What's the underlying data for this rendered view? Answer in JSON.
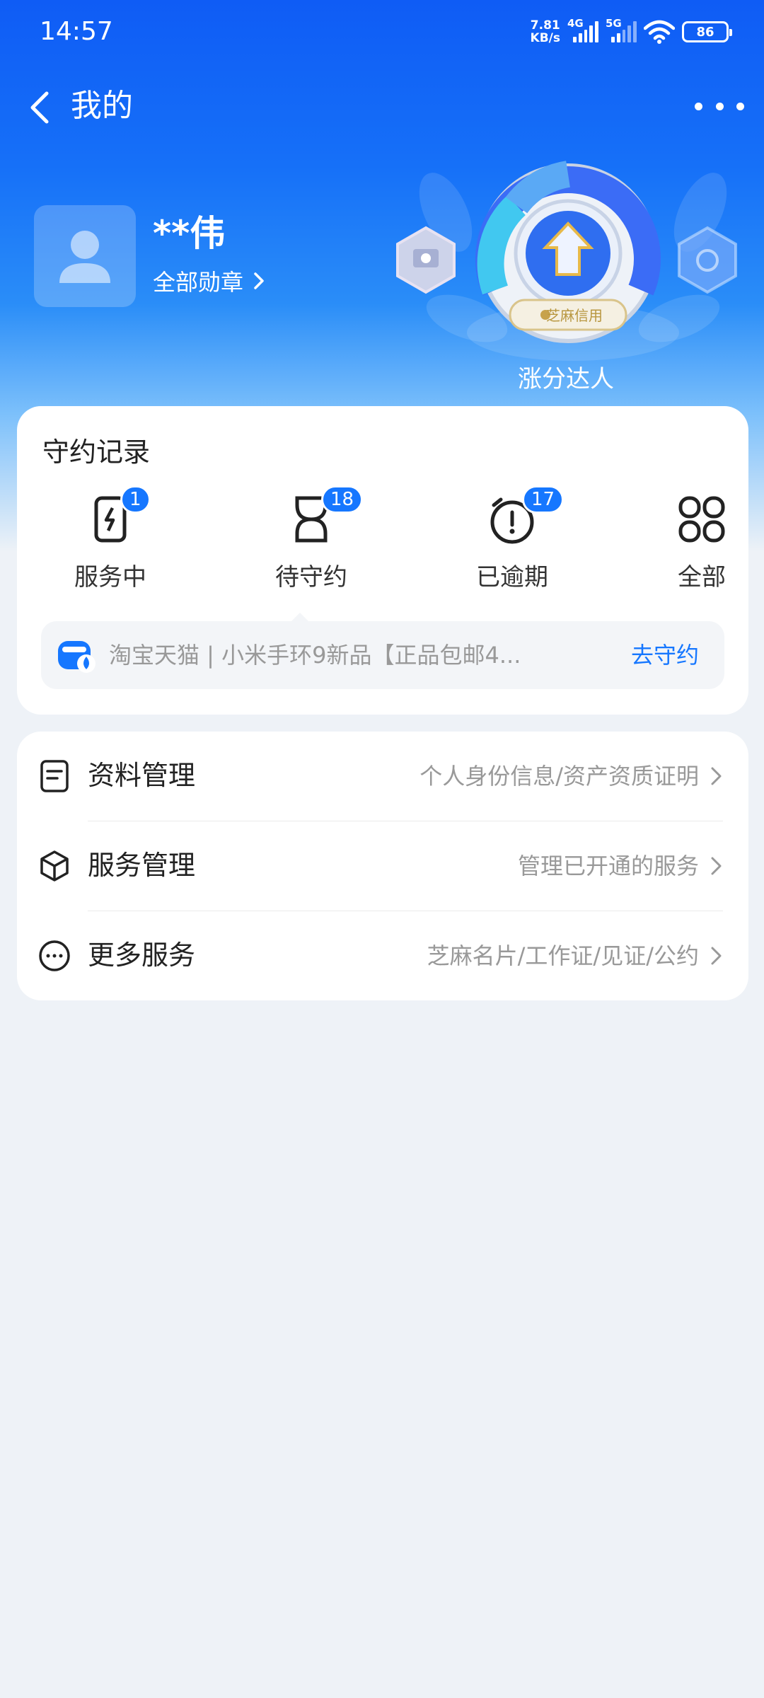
{
  "status_bar": {
    "time": "14:57",
    "net_speed_value": "7.81",
    "net_speed_unit": "KB/s",
    "sim1": "4G",
    "sim2": "5G",
    "battery": "86"
  },
  "nav": {
    "title": "我的",
    "back_icon": "chevron-left-icon",
    "more_icon": "more-dots-icon"
  },
  "profile": {
    "name": "**伟",
    "badges_link": "全部勋章",
    "badge_caption": "涨分达人",
    "badge_logo_text": "芝麻信用"
  },
  "records": {
    "title": "守约记录",
    "tabs": [
      {
        "label": "服务中",
        "count": "1",
        "icon": "phone-bolt-icon"
      },
      {
        "label": "待守约",
        "count": "18",
        "icon": "hourglass-icon"
      },
      {
        "label": "已逾期",
        "count": "17",
        "icon": "alarm-clock-icon"
      },
      {
        "label": "全部",
        "count": "",
        "icon": "grid-icon"
      }
    ],
    "notice": {
      "text": "淘宝天猫 | 小米手环9新品【正品包邮4...",
      "action": "去守约"
    }
  },
  "menu": [
    {
      "title": "资料管理",
      "desc": "个人身份信息/资产资质证明",
      "icon": "document-icon"
    },
    {
      "title": "服务管理",
      "desc": "管理已开通的服务",
      "icon": "cube-icon"
    },
    {
      "title": "更多服务",
      "desc": "芝麻名片/工作证/见证/公约",
      "icon": "more-circle-icon"
    }
  ],
  "colors": {
    "brand_blue": "#1677ff",
    "hero_top": "#0f5cf5",
    "page_bg": "#eef2f7"
  }
}
